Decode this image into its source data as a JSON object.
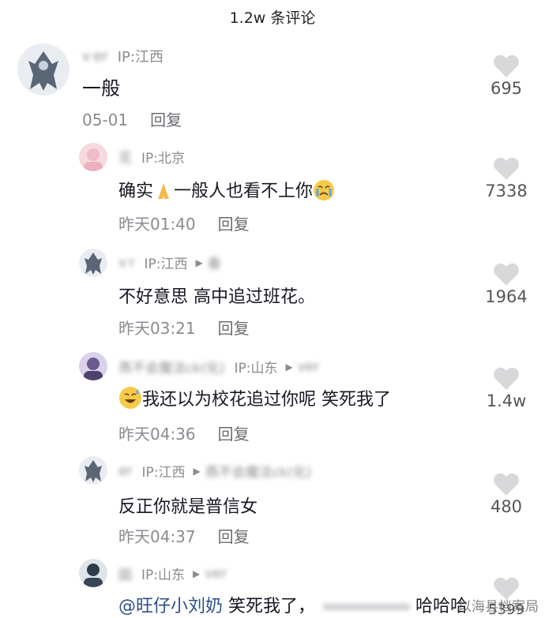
{
  "header": {
    "title": "1.2w 条评论"
  },
  "comments": [
    {
      "name": "v er",
      "ip": "IP:江西",
      "text": "一般",
      "time": "05-01",
      "reply": "回复",
      "likes": "695"
    },
    {
      "name": "花",
      "ip": "IP:北京",
      "text_before": "确实",
      "text_after": "一般人也看不上你",
      "time": "昨天01:40",
      "reply": "回复",
      "likes": "7338"
    },
    {
      "name": "v r",
      "ip": "IP:江西",
      "reply_to": "春",
      "text": "不好意思 高中追过班花。",
      "time": "昨天03:21",
      "reply": "回复",
      "likes": "1964"
    },
    {
      "name": "燕不会魔法ck(化)",
      "ip": "IP:山东",
      "reply_to": "ver",
      "text": "我还以为校花追过你呢 笑死我了",
      "time": "昨天04:36",
      "reply": "回复",
      "likes": "1.4w"
    },
    {
      "name": "er",
      "ip": "IP:江西",
      "reply_to": "燕不会魔法ck(化)",
      "text": "反正你就是普信女",
      "time": "昨天04:37",
      "reply": "回复",
      "likes": "480"
    },
    {
      "name": "囡",
      "ip": "IP:山东",
      "reply_to": "ver",
      "mention": "@旺仔小刘奶",
      "text": "笑死我了，",
      "text_end": "哈哈哈",
      "likes": "5399"
    }
  ],
  "watermark": "以海县档案局",
  "icons": {
    "like": "heart-icon",
    "reply_arrow": "reply-arrow-icon"
  }
}
